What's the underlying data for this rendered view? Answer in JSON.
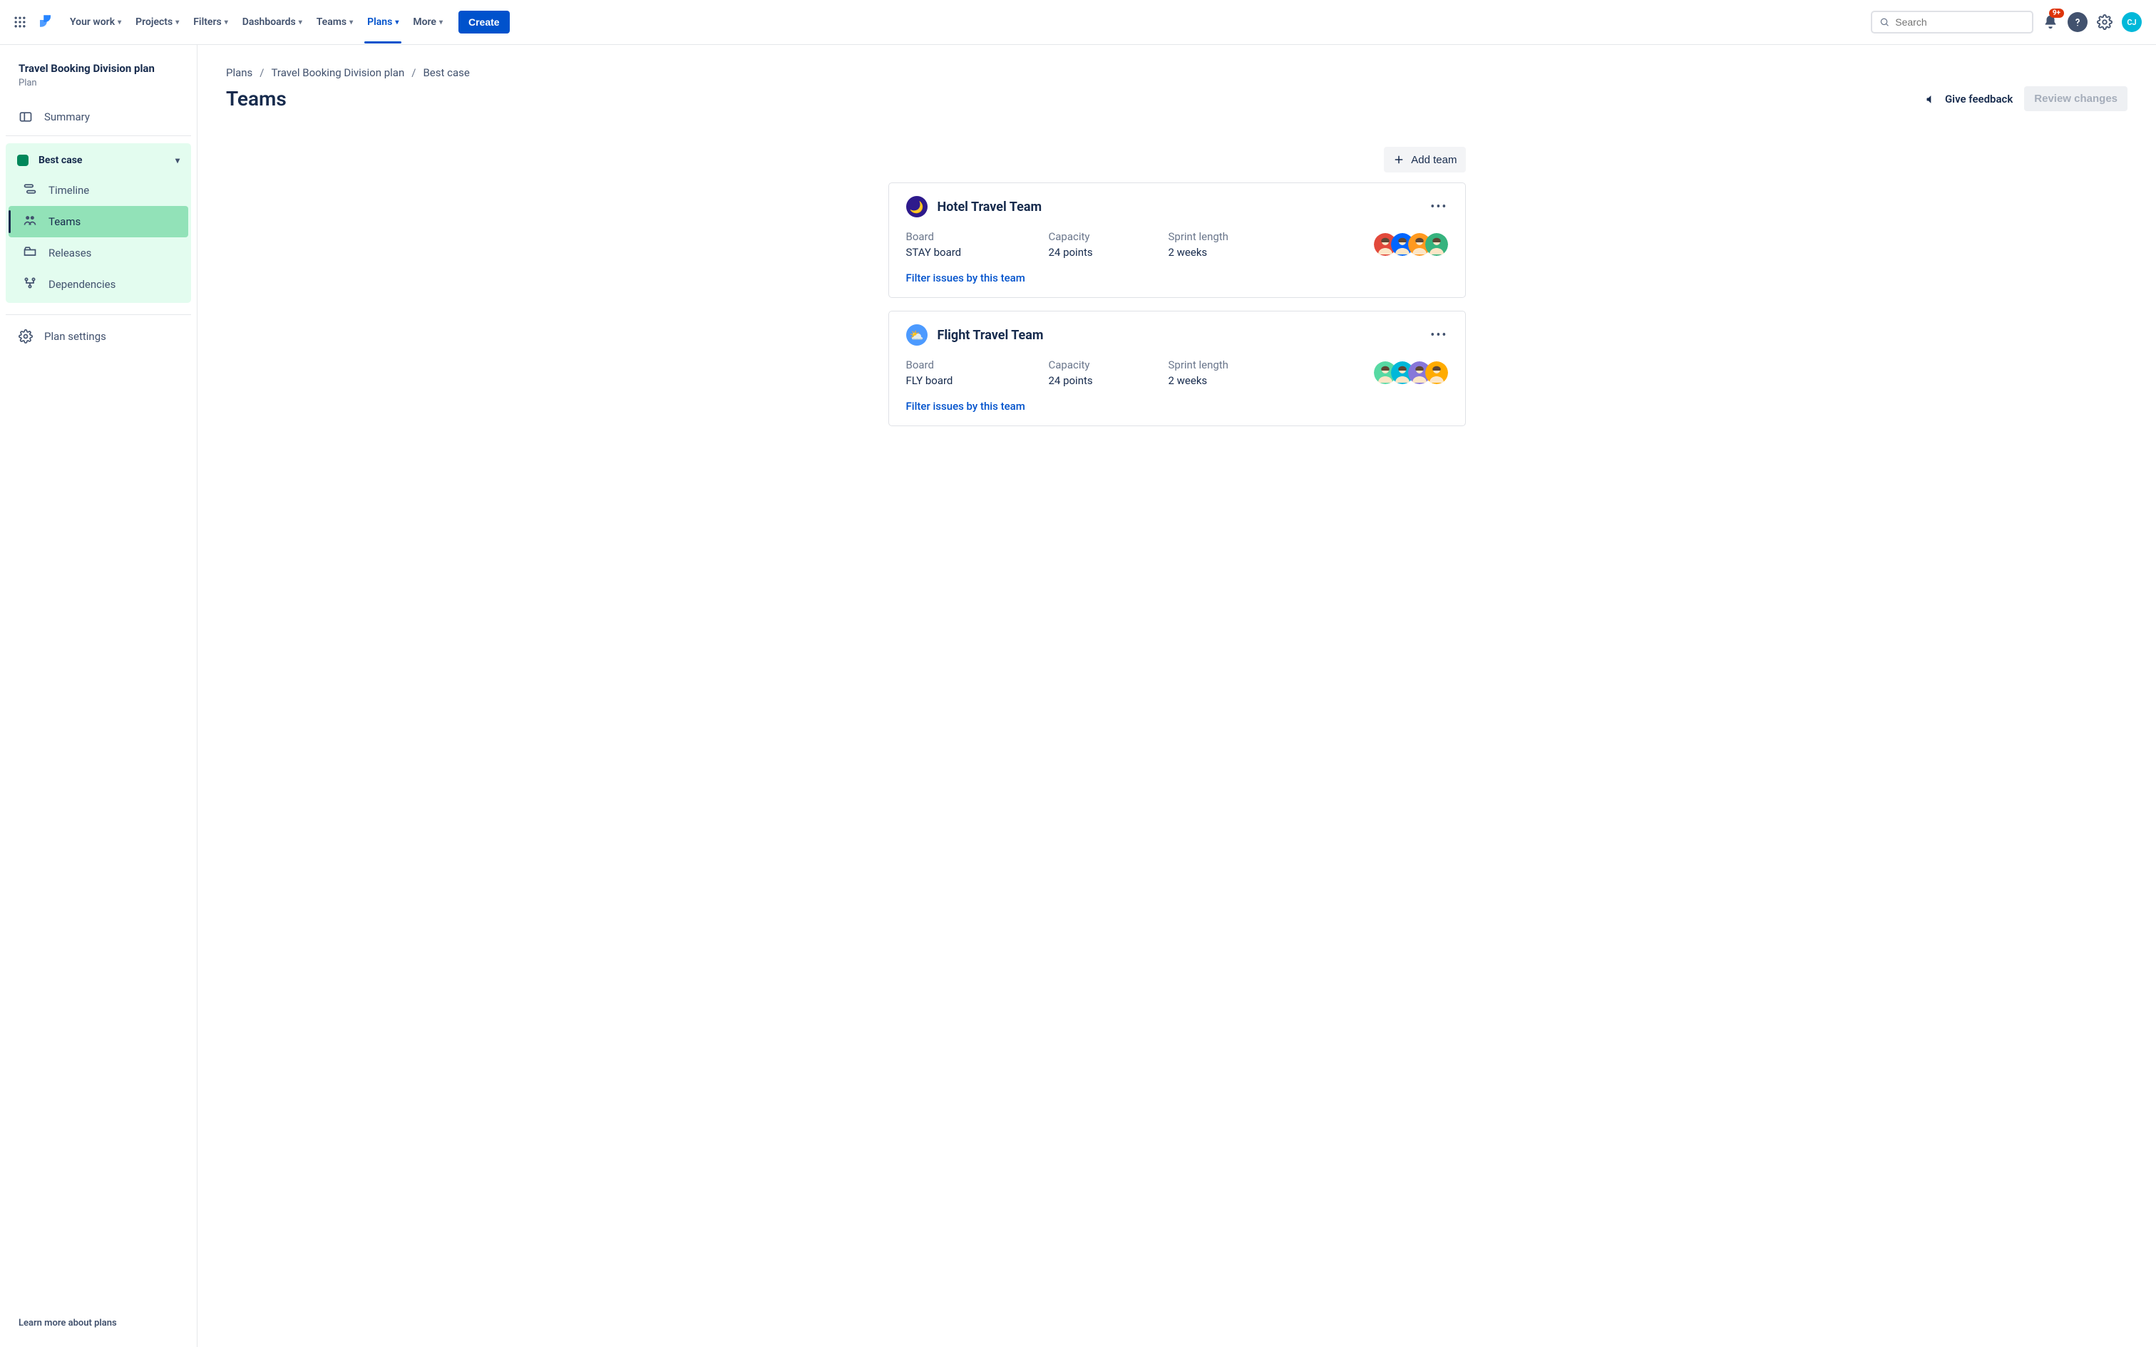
{
  "nav": {
    "items": [
      "Your work",
      "Projects",
      "Filters",
      "Dashboards",
      "Teams",
      "Plans",
      "More"
    ],
    "active_index": 5,
    "create": "Create",
    "search_placeholder": "Search",
    "notif_badge": "9+",
    "avatar_initials": "CJ"
  },
  "sidebar": {
    "title": "Travel Booking Division plan",
    "subtitle": "Plan",
    "summary": "Summary",
    "scenario": {
      "name": "Best case",
      "items": [
        "Timeline",
        "Teams",
        "Releases",
        "Dependencies"
      ],
      "active_index": 1
    },
    "settings": "Plan settings",
    "footer": "Learn more about plans"
  },
  "crumbs": [
    "Plans",
    "Travel Booking Division plan",
    "Best case"
  ],
  "page_title": "Teams",
  "feedback_label": "Give feedback",
  "review_label": "Review changes",
  "add_team": "Add team",
  "stat_labels": {
    "board": "Board",
    "capacity": "Capacity",
    "sprint": "Sprint length"
  },
  "filter_link": "Filter issues by this team",
  "teams": [
    {
      "name": "Hotel Travel Team",
      "icon_bg": "#2E1A8C",
      "icon_emoji": "🌙",
      "board": "STAY board",
      "capacity": "24 points",
      "sprint": "2 weeks",
      "avatars": [
        "#E2493B",
        "#0065FF",
        "#FF991F",
        "#36B37E"
      ]
    },
    {
      "name": "Flight Travel Team",
      "icon_bg": "#4C9AFF",
      "icon_emoji": "⛅",
      "board": "FLY board",
      "capacity": "24 points",
      "sprint": "2 weeks",
      "avatars": [
        "#57D9A3",
        "#00B8D9",
        "#8777D9",
        "#FFAB00"
      ]
    }
  ]
}
